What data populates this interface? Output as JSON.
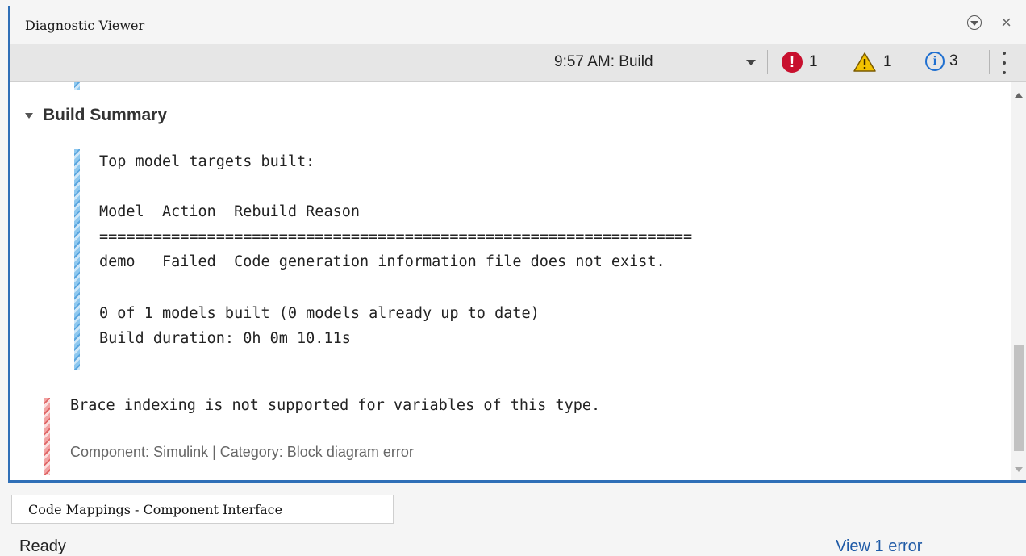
{
  "window": {
    "title": "Diagnostic Viewer"
  },
  "toolbar": {
    "build_selector": "9:57 AM: Build",
    "error_count": "1",
    "warning_count": "1",
    "info_count": "3",
    "error_icon_glyph": "!",
    "info_icon_glyph": "i"
  },
  "build_summary": {
    "heading": "Build Summary",
    "lines": [
      "Top model targets built:",
      "",
      "Model  Action  Rebuild Reason",
      "==================================================================",
      "demo   Failed  Code generation information file does not exist.",
      "",
      "0 of 1 models built (0 models already up to date)",
      "Build duration: 0h 0m 10.11s"
    ]
  },
  "error_message": {
    "text": "Brace indexing is not supported for variables of this type.",
    "meta": "Component: Simulink | Category: Block diagram error"
  },
  "bottom_tab": {
    "label": "Code Mappings - Component Interface"
  },
  "status_bar": {
    "status": "Ready",
    "link": "View 1 error"
  },
  "colors": {
    "accent_border": "#2f6fb7",
    "error_red": "#c8102e",
    "warning_yellow": "#f2c200",
    "info_blue": "#1f6fd0",
    "info_stripe": "#5aa6df",
    "error_stripe": "#e06767"
  },
  "icons": [
    "chevron-circle-down-icon",
    "close-icon",
    "error-icon",
    "warning-icon",
    "info-icon",
    "more-options-icon",
    "collapse-triangle-icon"
  ]
}
